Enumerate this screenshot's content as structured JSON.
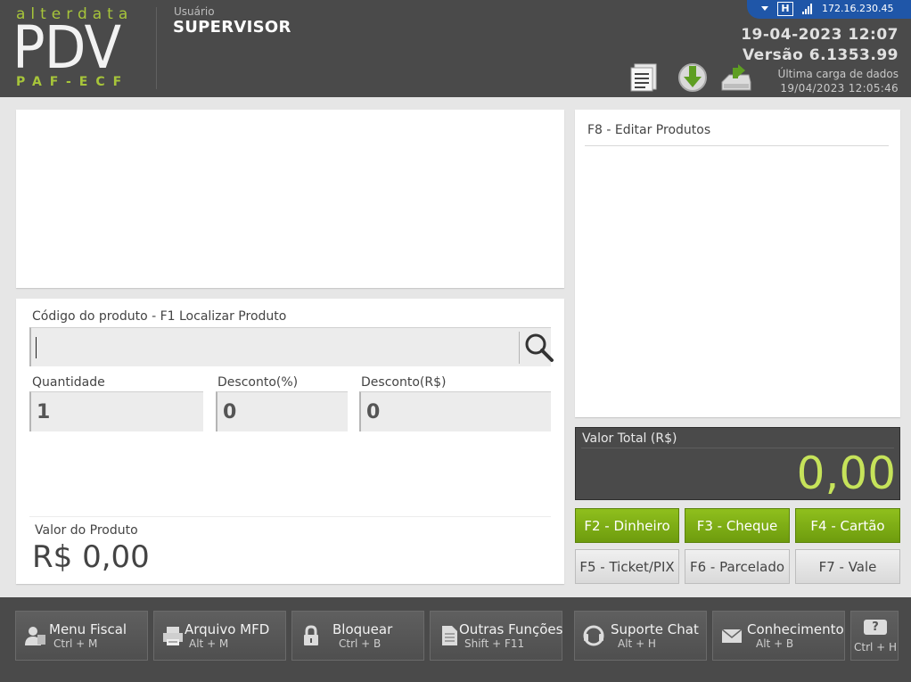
{
  "header": {
    "logo_top": "alterdata",
    "logo_main": "PDV",
    "logo_bottom": "PAF-ECF",
    "user_label": "Usuário",
    "user_name": "SUPERVISOR",
    "ip": "172.16.230.45",
    "net_glyph": "H",
    "date_time": "19-04-2023 12:07",
    "version": "Versão 6.1353.99",
    "last_load_label": "Última carga de dados",
    "last_load_value": "19/04/2023 12:05:46"
  },
  "entry": {
    "product_code_label": "Código do produto - F1 Localizar Produto",
    "product_code_value": "",
    "quantity_label": "Quantidade",
    "quantity_value": "1",
    "discount_pct_label": "Desconto(%)",
    "discount_pct_value": "0",
    "discount_val_label": "Desconto(R$)",
    "discount_val_value": "0",
    "product_value_label": "Valor do Produto",
    "product_value": "R$ 0,00"
  },
  "edit_panel": {
    "title": "F8 - Editar Produtos"
  },
  "total": {
    "label": "Valor Total (R$)",
    "value": "0,00"
  },
  "function_keys": [
    {
      "label": "F2 - Dinheiro",
      "style": "green"
    },
    {
      "label": "F3 - Cheque",
      "style": "green"
    },
    {
      "label": "F4 - Cartão",
      "style": "green"
    },
    {
      "label": "F5 - Ticket/PIX",
      "style": "gray"
    },
    {
      "label": "F6 - Parcelado",
      "style": "gray"
    },
    {
      "label": "F7 - Vale",
      "style": "gray"
    }
  ],
  "bottom_buttons": [
    {
      "title": "Menu Fiscal",
      "shortcut": "Ctrl + M",
      "icon": "user-icon"
    },
    {
      "title": "Arquivo MFD",
      "shortcut": "Alt + M",
      "icon": "printer-icon"
    },
    {
      "title": "Bloquear",
      "shortcut": "Ctrl + B",
      "icon": "lock-icon"
    },
    {
      "title": "Outras Funções",
      "shortcut": "Shift + F11",
      "icon": "document-icon"
    },
    {
      "title": "Suporte Chat",
      "shortcut": "Alt + H",
      "icon": "chat-icon"
    },
    {
      "title": "Conhecimento",
      "shortcut": "Alt + B",
      "icon": "mail-icon"
    },
    {
      "title": "?",
      "shortcut": "Ctrl + H",
      "icon": "help-icon"
    }
  ],
  "colors": {
    "accent_green": "#8fbf1d",
    "total_value": "#c6e35a",
    "header_bg": "#4a4a4a",
    "status_blue": "#1f56a8"
  }
}
